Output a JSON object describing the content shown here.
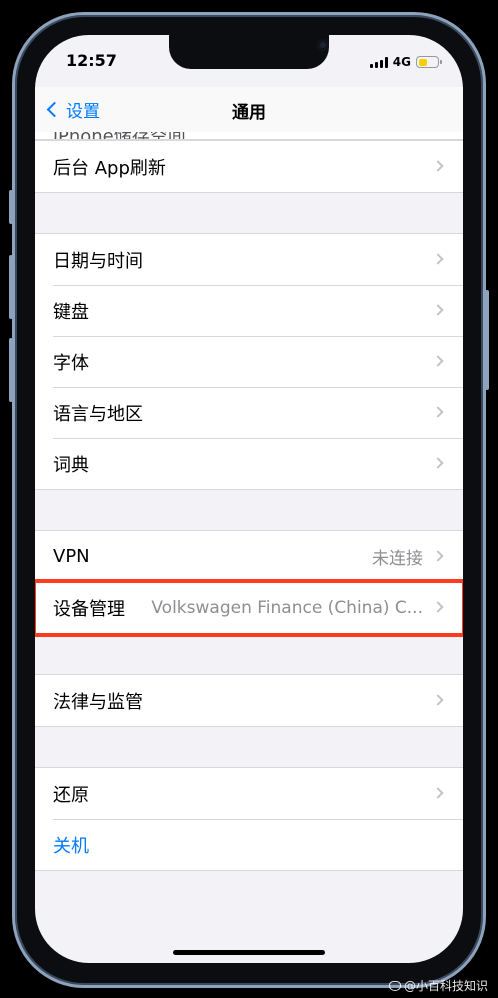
{
  "status": {
    "time": "12:57",
    "network": "4G"
  },
  "nav": {
    "back_label": "设置",
    "title": "通用"
  },
  "settings": {
    "partial_top_label": "iPhone储存空间",
    "groups": [
      {
        "rows": [
          {
            "label": "后台 App刷新"
          }
        ]
      },
      {
        "rows": [
          {
            "label": "日期与时间"
          },
          {
            "label": "键盘"
          },
          {
            "label": "字体"
          },
          {
            "label": "语言与地区"
          },
          {
            "label": "词典"
          }
        ]
      },
      {
        "rows": [
          {
            "label": "VPN",
            "value": "未连接"
          },
          {
            "label": "设备管理",
            "value": "Volkswagen Finance (China) C...",
            "highlighted": true
          }
        ]
      },
      {
        "rows": [
          {
            "label": "法律与监管"
          }
        ]
      },
      {
        "rows": [
          {
            "label": "还原"
          },
          {
            "label": "关机",
            "color": "#007aff"
          }
        ]
      }
    ]
  },
  "watermark": "@小百科技知识",
  "colors": {
    "accent": "#007aff",
    "highlight": "#ff3b1f",
    "battery": "#f7ce00"
  }
}
